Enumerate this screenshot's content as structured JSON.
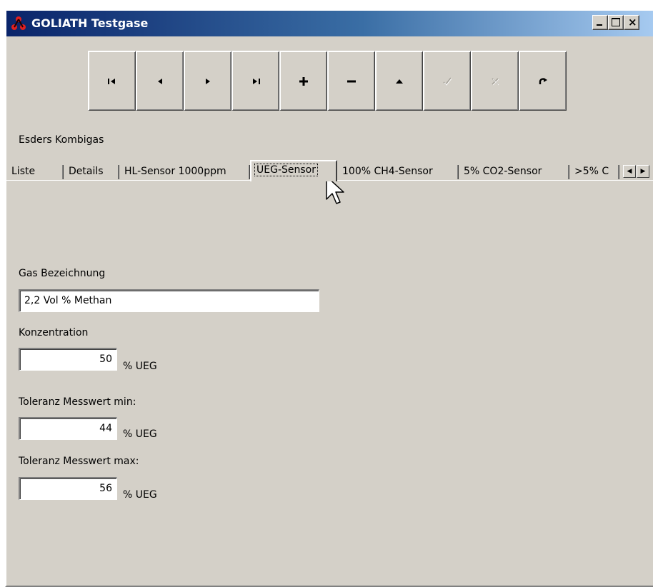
{
  "window": {
    "title": "GOLIATH Testgase",
    "title_icon": "goliath-logo-icon",
    "controls": [
      "minimize",
      "maximize",
      "close"
    ]
  },
  "toolbar": {
    "buttons": [
      {
        "name": "first-record",
        "icon": "skip-first-icon",
        "enabled": true
      },
      {
        "name": "prior-record",
        "icon": "triangle-left-icon",
        "enabled": true
      },
      {
        "name": "next-record",
        "icon": "triangle-right-icon",
        "enabled": true
      },
      {
        "name": "last-record",
        "icon": "skip-last-icon",
        "enabled": true
      },
      {
        "name": "insert",
        "icon": "plus-icon",
        "enabled": true
      },
      {
        "name": "delete",
        "icon": "minus-icon",
        "enabled": true
      },
      {
        "name": "edit",
        "icon": "triangle-up-icon",
        "enabled": true
      },
      {
        "name": "post",
        "icon": "checkmark-icon",
        "enabled": false
      },
      {
        "name": "cancel",
        "icon": "x-icon",
        "enabled": false
      },
      {
        "name": "refresh",
        "icon": "refresh-icon",
        "enabled": true
      }
    ]
  },
  "caption": "Esders Kombigas",
  "tabs": {
    "items": [
      "Liste",
      "Details",
      "HL-Sensor 1000ppm",
      "UEG-Sensor",
      "100% CH4-Sensor",
      "5% CO2-Sensor",
      ">5% C"
    ],
    "active": "UEG-Sensor"
  },
  "form": {
    "gas_label": "Gas Bezeichnung",
    "gas_value": "2,2 Vol % Methan",
    "konz_label": "Konzentration",
    "konz_value": "50",
    "konz_unit": "% UEG",
    "min_label": "Toleranz Messwert min:",
    "min_value": "44",
    "min_unit": "% UEG",
    "max_label": "Toleranz Messwert max:",
    "max_value": "56",
    "max_unit": "% UEG"
  },
  "colors": {
    "window_bg": "#d4d0c8",
    "titlebar_start": "#0a246a",
    "titlebar_end": "#a6caf0"
  }
}
